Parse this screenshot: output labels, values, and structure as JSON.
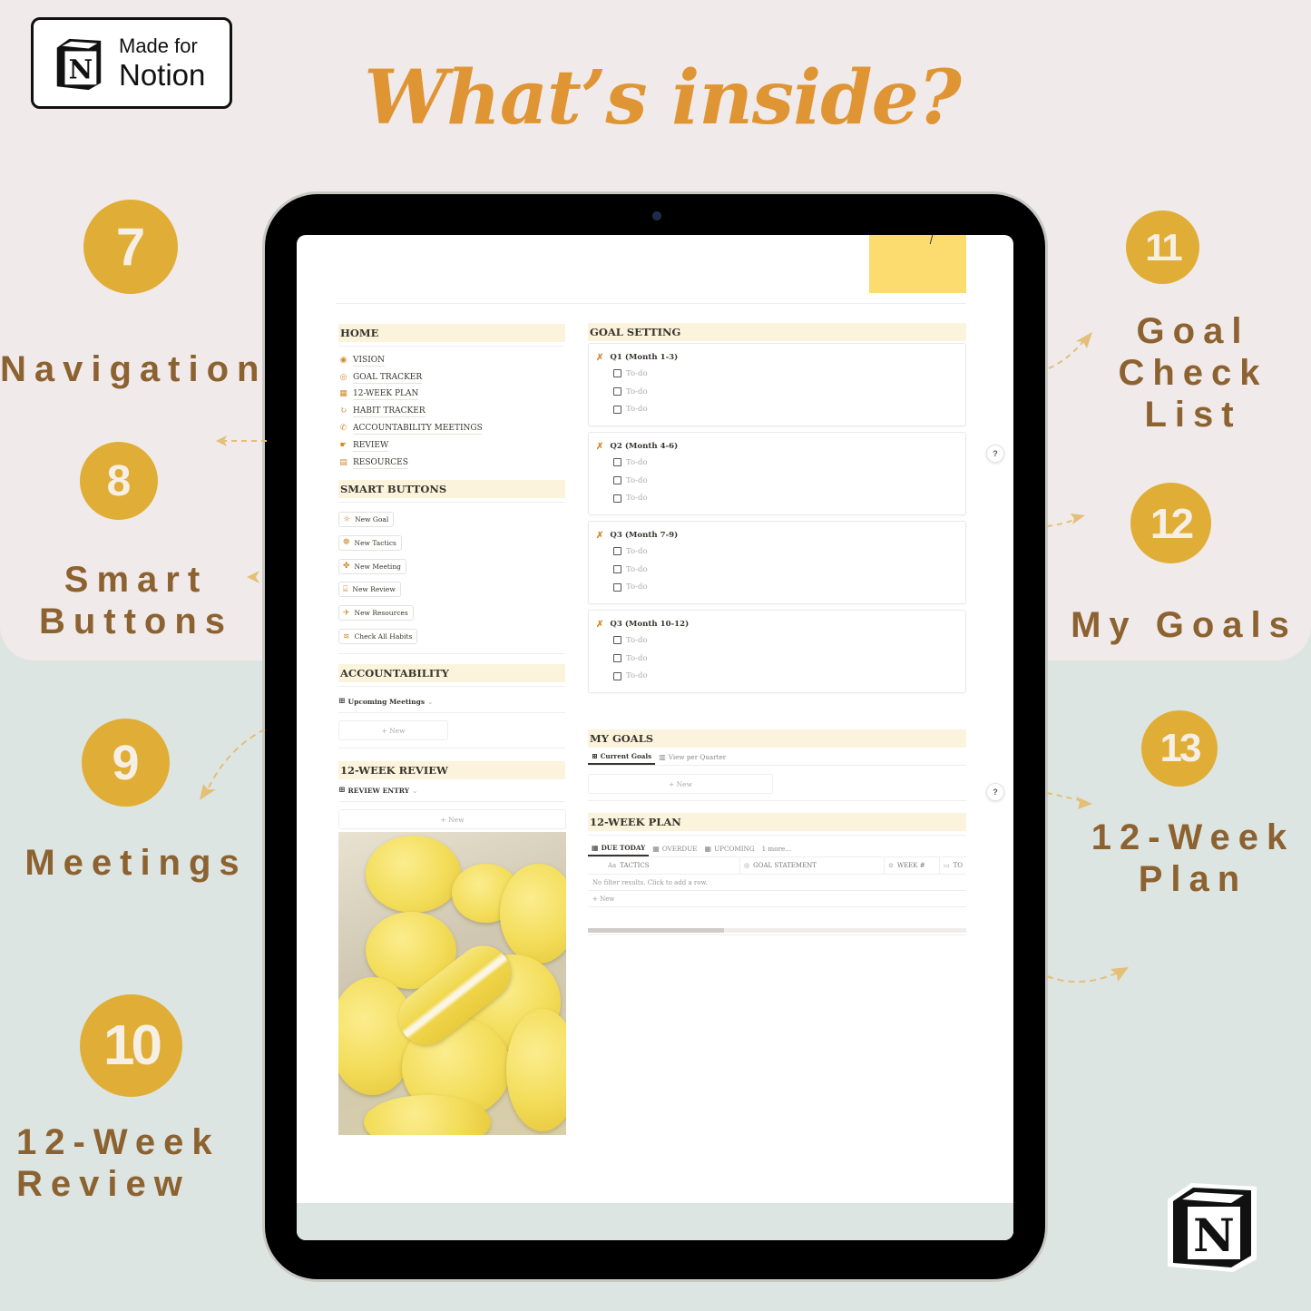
{
  "badge": {
    "line1": "Made for",
    "line2": "Notion",
    "icon": "notion-cube-icon"
  },
  "headline": "What’s inside?",
  "colors": {
    "accent_orange": "#e09535",
    "circle_gold": "#e0ae36",
    "label_brown": "#8d6231",
    "header_cream": "#fbf3db",
    "bg_top": "#f0eaea",
    "bg_bottom": "#dde5e2",
    "sticky_yellow": "#fcdc6e"
  },
  "callouts": [
    {
      "number": "7",
      "label_lines": [
        "Navigation"
      ]
    },
    {
      "number": "8",
      "label_lines": [
        "Smart",
        "Buttons"
      ]
    },
    {
      "number": "9",
      "label_lines": [
        "Meetings"
      ]
    },
    {
      "number": "10",
      "label_lines": [
        "12-Week",
        "Review"
      ]
    },
    {
      "number": "11",
      "label_lines": [
        "Goal",
        "Check",
        "List"
      ]
    },
    {
      "number": "12",
      "label_lines": [
        "My Goals"
      ]
    },
    {
      "number": "13",
      "label_lines": [
        "12-Week",
        "Plan"
      ]
    }
  ],
  "notion_page": {
    "home": {
      "title": "HOME",
      "items": [
        {
          "label": "VISION",
          "icon": "eye-icon"
        },
        {
          "label": "GOAL TRACKER",
          "icon": "target-icon"
        },
        {
          "label": "12-WEEK PLAN",
          "icon": "calendar-icon"
        },
        {
          "label": "HABIT TRACKER",
          "icon": "habit-refresh-icon"
        },
        {
          "label": "ACCOUNTABILITY MEETINGS",
          "icon": "phone-icon"
        },
        {
          "label": "REVIEW",
          "icon": "review-pointer-icon"
        },
        {
          "label": "RESOURCES",
          "icon": "briefcase-icon"
        }
      ]
    },
    "smart_buttons": {
      "title": "SMART BUTTONS",
      "buttons": [
        {
          "label": "New Goal",
          "icon": "sun-icon"
        },
        {
          "label": "New Tactics",
          "icon": "gear-flower-icon"
        },
        {
          "label": "New Meeting",
          "icon": "puzzle-icon"
        },
        {
          "label": "New Review",
          "icon": "toolbox-icon"
        },
        {
          "label": "New Resources",
          "icon": "airplane-icon"
        },
        {
          "label": "Check All Habits",
          "icon": "waves-icon"
        }
      ]
    },
    "accountability": {
      "title": "ACCOUNTABILITY",
      "view_label": "Upcoming Meetings",
      "new_label": "+ New"
    },
    "review": {
      "title": "12-WEEK REVIEW",
      "view_label": "REVIEW ENTRY",
      "new_label": "+ New",
      "image_alt": "yellow macarons"
    },
    "goal_setting": {
      "title": "GOAL SETTING",
      "quarters": [
        {
          "title": "Q1 (Month 1-3)",
          "todos": [
            "To-do",
            "To-do",
            "To-do"
          ]
        },
        {
          "title": "Q2 (Month 4-6)",
          "todos": [
            "To-do",
            "To-do",
            "To-do"
          ]
        },
        {
          "title": "Q3 (Month 7-9)",
          "todos": [
            "To-do",
            "To-do",
            "To-do"
          ]
        },
        {
          "title": "Q3 (Month 10-12)",
          "todos": [
            "To-do",
            "To-do",
            "To-do"
          ]
        }
      ]
    },
    "my_goals": {
      "title": "MY GOALS",
      "tabs": [
        "Current Goals",
        "View per Quarter"
      ],
      "new_label": "+ New"
    },
    "plan": {
      "title": "12-WEEK PLAN",
      "tabs": [
        "DUE TODAY",
        "OVERDUE",
        "UPCOMING",
        "1 more..."
      ],
      "columns": [
        {
          "label": "TACTICS",
          "icon": "Aa"
        },
        {
          "label": "GOAL STATEMENT",
          "icon": "target-icon"
        },
        {
          "label": "WEEK #",
          "icon": "select-icon"
        },
        {
          "label": "TO",
          "icon": "date-icon"
        }
      ],
      "empty_text": "No filter results. Click to add a row.",
      "new_label": "+ New",
      "scroll_position": 0.36
    },
    "help_label": "?"
  }
}
